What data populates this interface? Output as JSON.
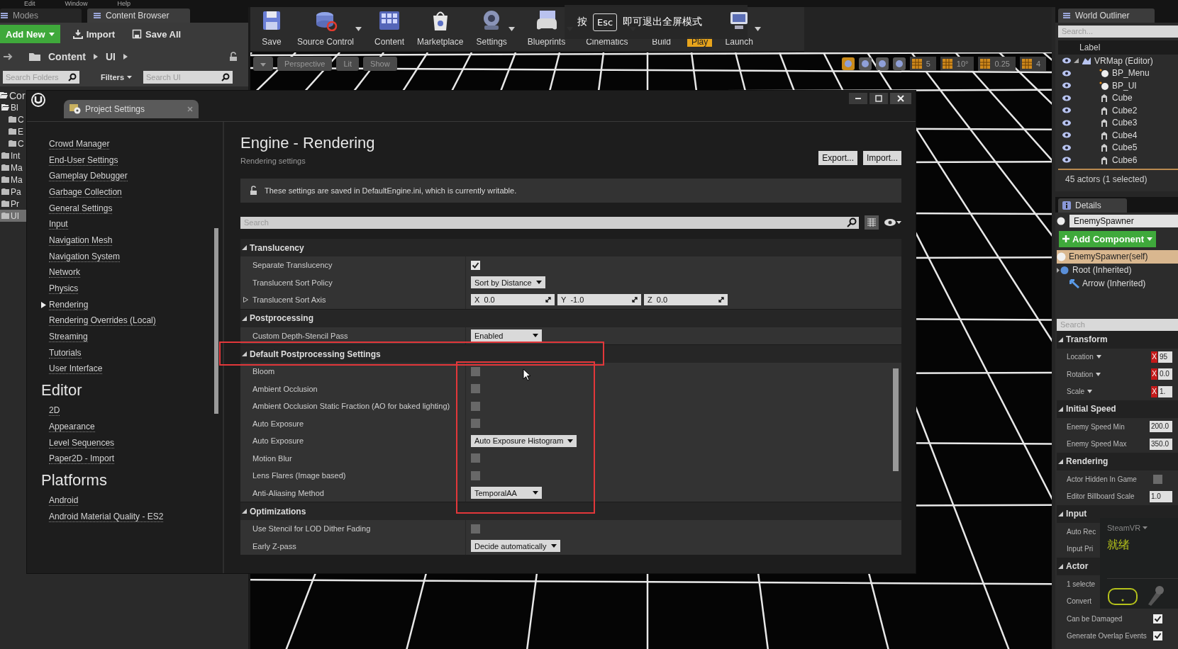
{
  "menu_bar": [
    "Edit",
    "Window",
    "Help"
  ],
  "content_browser": {
    "tabs": [
      {
        "label": "Modes",
        "selected": false
      },
      {
        "label": "Content Browser",
        "selected": true
      }
    ],
    "add_new": "Add New",
    "import": "Import",
    "save_all": "Save All",
    "path": [
      "Content",
      "UI"
    ],
    "folder_search": {
      "placeholder": "Search Folders"
    },
    "filters": "Filters",
    "asset_search": {
      "placeholder": "Search UI"
    },
    "folders": [
      {
        "label": "Cor",
        "expanded": true,
        "selected": false,
        "children": [
          {
            "label": "Bl",
            "expanded": true,
            "selected": false,
            "children": [
              {
                "label": "C",
                "selected": false
              },
              {
                "label": "E",
                "selected": false
              },
              {
                "label": "C",
                "selected": false
              }
            ]
          },
          {
            "label": "Int",
            "expanded": false,
            "selected": false
          },
          {
            "label": "Ma",
            "expanded": false,
            "selected": false
          },
          {
            "label": "Ma",
            "expanded": false,
            "selected": false
          },
          {
            "label": "Pa",
            "expanded": false,
            "selected": false
          },
          {
            "label": "Pr",
            "expanded": false,
            "selected": false
          },
          {
            "label": "UI",
            "expanded": false,
            "selected": true
          }
        ]
      }
    ]
  },
  "toolbar": [
    {
      "label": "Save",
      "menu": false,
      "active": false
    },
    {
      "label": "Source Control",
      "menu": true,
      "active": false
    },
    {
      "label": "Content",
      "menu": false,
      "active": false
    },
    {
      "label": "Marketplace",
      "menu": false,
      "active": false
    },
    {
      "label": "Settings",
      "menu": true,
      "active": false
    },
    {
      "label": "Blueprints",
      "menu": true,
      "active": false
    },
    {
      "label": "Cinematics",
      "menu": true,
      "active": false,
      "icon_covered": true
    },
    {
      "label": "Build",
      "menu": false,
      "active": false,
      "icon_covered": true
    },
    {
      "label": "Play",
      "menu": false,
      "active": true,
      "icon_covered": true
    },
    {
      "label": "Launch",
      "menu": true,
      "active": false
    }
  ],
  "fullscreen_toast": {
    "before": "按",
    "key": "Esc",
    "after": "即可退出全屏模式"
  },
  "viewport": {
    "view": "Perspective",
    "mode": "Lit",
    "show": "Show",
    "snap_values": [
      "5",
      "10°",
      "0.25",
      "4"
    ]
  },
  "outliner": {
    "tab": "World Outliner",
    "search": {
      "placeholder": "Search..."
    },
    "column": "Label",
    "rows": [
      {
        "label": "VRMap (Editor)",
        "kind": "map",
        "expanded": true,
        "children": [
          {
            "label": "BP_Menu",
            "kind": "blueprint"
          },
          {
            "label": "BP_UI",
            "kind": "blueprint"
          },
          {
            "label": "Cube",
            "kind": "mesh"
          },
          {
            "label": "Cube2",
            "kind": "mesh"
          },
          {
            "label": "Cube3",
            "kind": "mesh"
          },
          {
            "label": "Cube4",
            "kind": "mesh"
          },
          {
            "label": "Cube5",
            "kind": "mesh"
          },
          {
            "label": "Cube6",
            "kind": "mesh"
          }
        ]
      }
    ],
    "footer": "45 actors (1 selected)"
  },
  "details": {
    "tab": "Details",
    "name": "EnemySpawner",
    "add_component": "Add Component",
    "components": [
      {
        "label": "EnemySpawner(self)",
        "kind": "self",
        "selected": true
      },
      {
        "label": "Root (Inherited)",
        "kind": "root",
        "selected": false
      },
      {
        "label": "Arrow (Inherited)",
        "kind": "arrow",
        "selected": false
      }
    ],
    "search": {
      "placeholder": "Search"
    },
    "categories": [
      {
        "title": "Transform",
        "rows": [
          {
            "label": "Location",
            "kind": "vector",
            "axis": "X",
            "value": "95"
          },
          {
            "label": "Rotation",
            "kind": "vector",
            "axis": "X",
            "value": "0.0"
          },
          {
            "label": "Scale",
            "kind": "vector",
            "axis": "X",
            "value": "1."
          }
        ]
      },
      {
        "title": "Initial Speed",
        "rows": [
          {
            "label": "Enemy Speed Min",
            "kind": "number",
            "value": "200.0"
          },
          {
            "label": "Enemy Speed Max",
            "kind": "number",
            "value": "350.0"
          }
        ]
      },
      {
        "title": "Rendering",
        "rows": [
          {
            "label": "Actor Hidden In Game",
            "kind": "checkbox",
            "checked": false
          },
          {
            "label": "Editor Billboard Scale",
            "kind": "number",
            "value": "1.0"
          }
        ]
      },
      {
        "title": "Input",
        "rows": [
          {
            "label": "Auto Rec",
            "kind": "plain"
          },
          {
            "label": "Input Pri",
            "kind": "plain"
          }
        ]
      },
      {
        "title": "Actor",
        "rows": [
          {
            "label": "1 selecte",
            "kind": "plain"
          },
          {
            "label": "Convert",
            "kind": "plain"
          },
          {
            "label": "Can be Damaged",
            "kind": "checkbox",
            "checked": true
          },
          {
            "label": "Generate Overlap Events",
            "kind": "checkbox",
            "checked": true
          }
        ]
      }
    ]
  },
  "steamvr": {
    "title": "SteamVR",
    "status": "就绪"
  },
  "settings_window": {
    "tab": "Project Settings",
    "nav": [
      {
        "items": [
          {
            "label": "Crowd Manager",
            "selected": false
          },
          {
            "label": "End-User Settings",
            "selected": false
          },
          {
            "label": "Gameplay Debugger",
            "selected": false
          },
          {
            "label": "Garbage Collection",
            "selected": false
          },
          {
            "label": "General Settings",
            "selected": false
          },
          {
            "label": "Input",
            "selected": false
          },
          {
            "label": "Navigation Mesh",
            "selected": false
          },
          {
            "label": "Navigation System",
            "selected": false
          },
          {
            "label": "Network",
            "selected": false
          },
          {
            "label": "Physics",
            "selected": false
          },
          {
            "label": "Rendering",
            "selected": true
          },
          {
            "label": "Rendering Overrides (Local)",
            "selected": false
          },
          {
            "label": "Streaming",
            "selected": false
          },
          {
            "label": "Tutorials",
            "selected": false
          },
          {
            "label": "User Interface",
            "selected": false
          }
        ]
      },
      {
        "title": "Editor",
        "items": [
          {
            "label": "2D",
            "selected": false
          },
          {
            "label": "Appearance",
            "selected": false
          },
          {
            "label": "Level Sequences",
            "selected": false
          },
          {
            "label": "Paper2D - Import",
            "selected": false
          }
        ]
      },
      {
        "title": "Platforms",
        "items": [
          {
            "label": "Android",
            "selected": false
          },
          {
            "label": "Android Material Quality - ES2",
            "selected": false
          }
        ]
      }
    ],
    "title": "Engine - Rendering",
    "subtitle": "Rendering settings",
    "export": "Export...",
    "import": "Import...",
    "notice": "These settings are saved in DefaultEngine.ini, which is currently writable.",
    "search": {
      "placeholder": "Search"
    },
    "sections": [
      {
        "title": "Translucency",
        "expanded": true,
        "rows": [
          {
            "label": "Separate Translucency",
            "kind": "checkbox",
            "checked": true
          },
          {
            "label": "Translucent Sort Policy",
            "kind": "dropdown",
            "value": "Sort by Distance"
          },
          {
            "label": "Translucent Sort Axis",
            "kind": "vector",
            "expanded": false,
            "values": [
              {
                "axis": "X",
                "value": "0.0"
              },
              {
                "axis": "Y",
                "value": "-1.0"
              },
              {
                "axis": "Z",
                "value": "0.0"
              }
            ]
          }
        ]
      },
      {
        "title": "Postprocessing",
        "expanded": true,
        "rows": [
          {
            "label": "Custom Depth-Stencil Pass",
            "kind": "dropdown",
            "value": "Enabled"
          }
        ]
      },
      {
        "title": "Default Postprocessing Settings",
        "expanded": true,
        "rows": [
          {
            "label": "Bloom",
            "kind": "checkbox",
            "checked": false
          },
          {
            "label": "Ambient Occlusion",
            "kind": "checkbox",
            "checked": false
          },
          {
            "label": "Ambient Occlusion Static Fraction (AO for baked lighting)",
            "kind": "checkbox",
            "checked": false
          },
          {
            "label": "Auto Exposure",
            "kind": "checkbox",
            "checked": false
          },
          {
            "label": "Auto Exposure",
            "kind": "dropdown",
            "value": "Auto Exposure Histogram"
          },
          {
            "label": "Motion Blur",
            "kind": "checkbox",
            "checked": false
          },
          {
            "label": "Lens Flares (Image based)",
            "kind": "checkbox",
            "checked": false
          },
          {
            "label": "Anti-Aliasing Method",
            "kind": "dropdown",
            "value": "TemporalAA"
          }
        ]
      },
      {
        "title": "Optimizations",
        "expanded": true,
        "rows": [
          {
            "label": "Use Stencil for LOD Dither Fading",
            "kind": "checkbox",
            "checked": false
          },
          {
            "label": "Early Z-pass",
            "kind": "dropdown",
            "value": "Decide automatically"
          }
        ]
      }
    ]
  }
}
